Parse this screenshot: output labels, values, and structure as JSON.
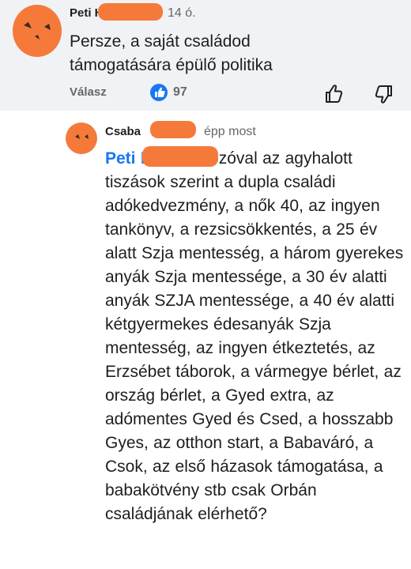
{
  "top_comment": {
    "author": "Peti H",
    "time": "14 ó.",
    "text_line1": "Persze,  a saját családod",
    "text_line2": "támogatására épülő politika",
    "reply_label": "Válasz",
    "like_count": "97",
    "like_icon": "thumbs-up-icon",
    "dislike_icon": "thumbs-down-icon"
  },
  "reply_comment": {
    "author": "Csaba",
    "time": "épp most",
    "mention": "Peti H",
    "text": "Szóval az agyhalott tiszások szerint a dupla családi adókedvezmény, a nők 40, az ingyen tankönyv, a rezsicsökkentés, a 25 év alatt Szja mentesség, a három gyerekes anyák Szja mentessége, a 30 év alatti anyák SZJA mentessége, a 40 év alatti kétgyermekes édesanyák Szja mentesség, az ingyen étkeztetés, az Erzsébet táborok, a vármegye bérlet, az ország bérlet, a Gyed extra, az adómentes Gyed és Csed, a hosszabb Gyes, az otthon start, a Babaváró, a Csok, az első házasok támogatása, a babakötvény stb csak Orbán családjának elérhető?"
  },
  "colors": {
    "top_bg": "#f0f2f5",
    "link_blue": "#1877f2",
    "redaction_orange": "#f57a3a",
    "meta_gray": "#65676b"
  }
}
